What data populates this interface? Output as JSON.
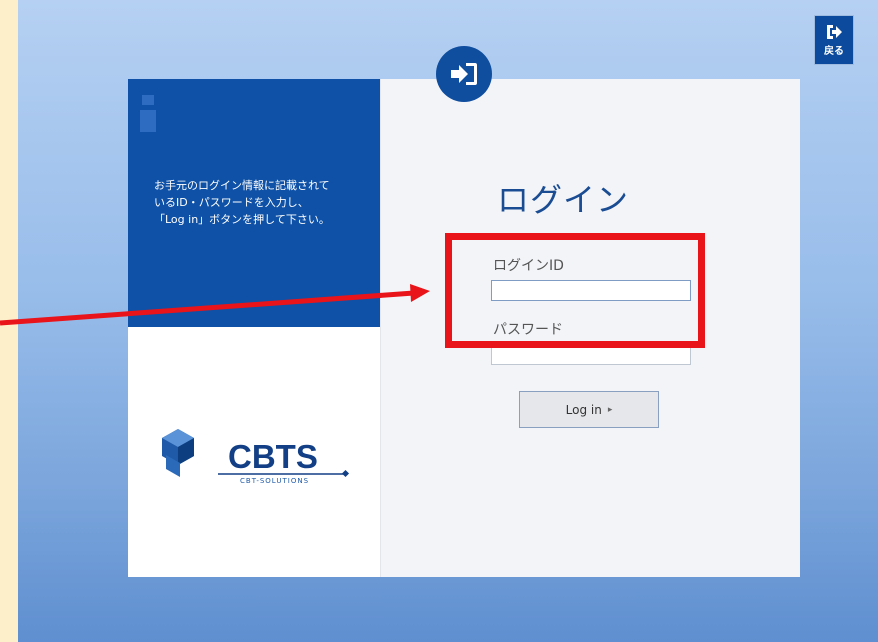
{
  "header": {
    "back_label": "戻る",
    "back_icon": "exit-icon"
  },
  "info_panel": {
    "icon": "info-icon",
    "text": "お手元のログイン情報に記載されて\nいるID・パスワードを入力し、\n「Log in」ボタンを押して下さい。"
  },
  "logo": {
    "name": "CBTS",
    "subtitle": "CBT-SOLUTIONS"
  },
  "form": {
    "login_icon": "sign-in-icon",
    "title": "ログイン",
    "id_label": "ログインID",
    "id_value": "",
    "password_label": "パスワード",
    "password_value": "",
    "submit_label": "Log in",
    "submit_arrow": "▸"
  },
  "annotation": {
    "highlight_color": "#e8141a"
  },
  "colors": {
    "primary": "#0e51a6",
    "title": "#1a4c93",
    "page_bg": "#fdefc9"
  }
}
